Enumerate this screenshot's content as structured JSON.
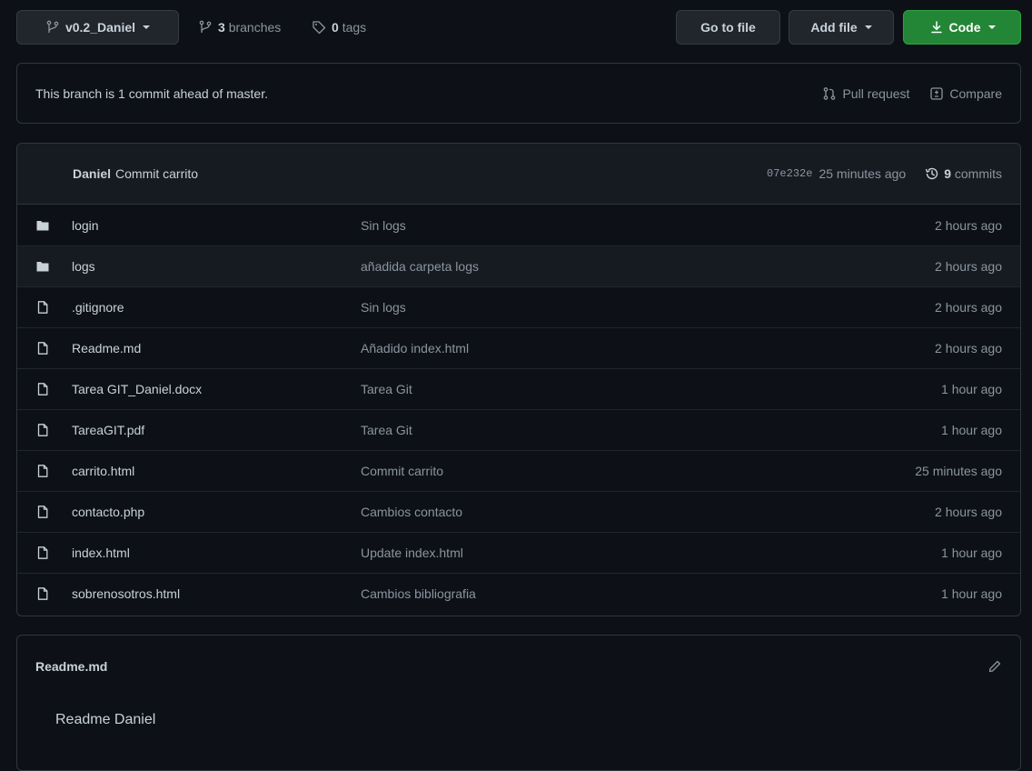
{
  "toolbar": {
    "branch": "v0.2_Daniel",
    "branches_count": "3",
    "branches_label": "branches",
    "tags_count": "0",
    "tags_label": "tags",
    "go_to_file": "Go to file",
    "add_file": "Add file",
    "code": "Code"
  },
  "ahead": {
    "text": "This branch is 1 commit ahead of master.",
    "pull_request": "Pull request",
    "compare": "Compare"
  },
  "latest_commit": {
    "author": "Daniel",
    "message": "Commit carrito",
    "sha": "07e232e",
    "age": "25 minutes ago",
    "commits_count": "9",
    "commits_label": "commits"
  },
  "files": [
    {
      "name": "login",
      "type": "folder",
      "message": "Sin logs",
      "age": "2 hours ago"
    },
    {
      "name": "logs",
      "type": "folder",
      "message": "añadida carpeta logs",
      "age": "2 hours ago"
    },
    {
      "name": ".gitignore",
      "type": "file",
      "message": "Sin logs",
      "age": "2 hours ago"
    },
    {
      "name": "Readme.md",
      "type": "file",
      "message": "Añadido index.html",
      "age": "2 hours ago"
    },
    {
      "name": "Tarea GIT_Daniel.docx",
      "type": "file",
      "message": "Tarea Git",
      "age": "1 hour ago"
    },
    {
      "name": "TareaGIT.pdf",
      "type": "file",
      "message": "Tarea Git",
      "age": "1 hour ago"
    },
    {
      "name": "carrito.html",
      "type": "file",
      "message": "Commit carrito",
      "age": "25 minutes ago"
    },
    {
      "name": "contacto.php",
      "type": "file",
      "message": "Cambios contacto",
      "age": "2 hours ago"
    },
    {
      "name": "index.html",
      "type": "file",
      "message": "Update index.html",
      "age": "1 hour ago"
    },
    {
      "name": "sobrenosotros.html",
      "type": "file",
      "message": "Cambios bibliografia",
      "age": "1 hour ago"
    }
  ],
  "readme": {
    "title": "Readme.md",
    "body": "Readme Daniel"
  },
  "colors": {
    "background": "#0d1117",
    "border": "#30363d",
    "green_button": "#238636",
    "muted_text": "#8b949e",
    "folder_icon": "#c9d1d9"
  },
  "icons": [
    "git-branch-icon",
    "tag-icon",
    "download-icon",
    "pull-request-icon",
    "compare-icon",
    "history-icon",
    "folder-icon",
    "file-icon",
    "pencil-icon"
  ]
}
